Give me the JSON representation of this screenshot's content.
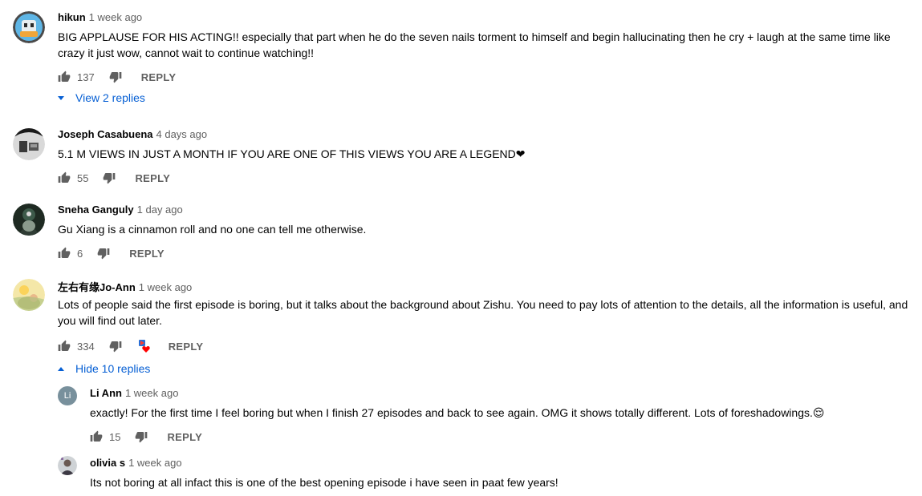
{
  "comments": [
    {
      "author": "hikun",
      "time": "1 week ago",
      "text": "BIG APPLAUSE FOR HIS ACTING!! especially that part when he do the seven nails torment to himself and begin hallucinating then he cry + laugh at the same time like crazy it just wow, cannot wait to continue watching!!",
      "likes": "137",
      "reply_label": "REPLY",
      "toggle_label": "View 2 replies"
    },
    {
      "author": "Joseph Casabuena",
      "time": "4 days ago",
      "text": "5.1 M VIEWS IN JUST A MONTH IF YOU ARE ONE OF THIS VIEWS YOU ARE A LEGEND❤",
      "likes": "55",
      "reply_label": "REPLY"
    },
    {
      "author": "Sneha Ganguly",
      "time": "1 day ago",
      "text": "Gu Xiang is a cinnamon roll and no one can tell me otherwise.",
      "likes": "6",
      "reply_label": "REPLY"
    },
    {
      "author": "左右有缘Jo-Ann",
      "time": "1 week ago",
      "text": "Lots of people said the first episode is boring, but it talks about the background about Zishu. You need to pay lots of attention to the details, all the information is useful, and you will find out later.",
      "likes": "334",
      "reply_label": "REPLY",
      "toggle_label": "Hide 10 replies"
    }
  ],
  "replies": [
    {
      "author": "Li Ann",
      "avatar_letter": "Li",
      "time": "1 week ago",
      "text": "exactly! For the first time I feel boring but when I finish 27 episodes and back to see again. OMG it shows totally different. Lots of foreshadowings.😌",
      "likes": "15",
      "reply_label": "REPLY"
    },
    {
      "author": "olivia s",
      "time": "1 week ago",
      "text": "Its not boring at all infact this is one of the best opening episode i have seen in paat few years!"
    }
  ],
  "colors": {
    "link": "#065fd4",
    "meta": "#606060",
    "text": "#030303",
    "heart": "#ff0000",
    "li_ann_avatar": "#78909c"
  }
}
